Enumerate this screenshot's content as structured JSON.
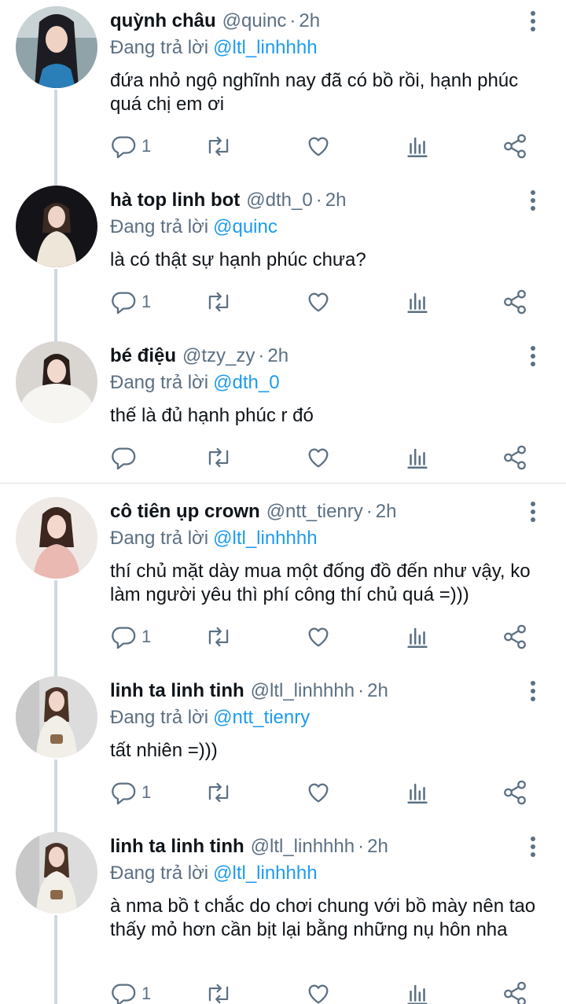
{
  "colors": {
    "link": "#1d9bf0",
    "muted": "#5b7083",
    "text": "#0f1419",
    "thread": "#cfd9de"
  },
  "tweets": [
    {
      "name": "quỳnh châu",
      "handle": "@quinc",
      "time": "2h",
      "reply_prefix": "Đang trả lời",
      "reply_to": "@ltl_linhhhh",
      "text": "đứa nhỏ ngộ nghĩnh nay đã có bồ rồi, hạnh phúc quá chị em ơi",
      "reply_count": "1"
    },
    {
      "name": "hà top linh bot",
      "handle": "@dth_0",
      "time": "2h",
      "reply_prefix": "Đang trả lời",
      "reply_to": "@quinc",
      "text": "là có thật sự hạnh phúc chưa?",
      "reply_count": "1"
    },
    {
      "name": "bé điệu",
      "handle": "@tzy_zy",
      "time": "2h",
      "reply_prefix": "Đang trả lời",
      "reply_to": "@dth_0",
      "text": "thế là đủ hạnh phúc r đó",
      "reply_count": ""
    },
    {
      "name": "cô tiên ụp crown",
      "handle": "@ntt_tienry",
      "time": "2h",
      "reply_prefix": "Đang trả lời",
      "reply_to": "@ltl_linhhhh",
      "text": "thí chủ mặt dày mua một đống đồ đến như vậy, ko làm người yêu thì phí công thí chủ quá =)))",
      "reply_count": "1"
    },
    {
      "name": "linh ta linh tinh",
      "handle": "@ltl_linhhhh",
      "time": "2h",
      "reply_prefix": "Đang trả lời",
      "reply_to": "@ntt_tienry",
      "text": "tất nhiên =)))",
      "reply_count": "1"
    },
    {
      "name": "linh ta linh tinh",
      "handle": "@ltl_linhhhh",
      "time": "2h",
      "reply_prefix": "Đang trả lời",
      "reply_to": "@ltl_linhhhh",
      "text": "à nma bồ t chắc do chơi chung với bồ mày nên tao thấy mỏ hơn cần bịt lại bằng những nụ hôn nha",
      "reply_count": "1"
    }
  ],
  "icons": {
    "reply": "reply-icon",
    "retweet": "retweet-icon",
    "like": "heart-icon",
    "analytics": "analytics-icon",
    "share": "share-icon",
    "more": "more-vertical-icon"
  }
}
